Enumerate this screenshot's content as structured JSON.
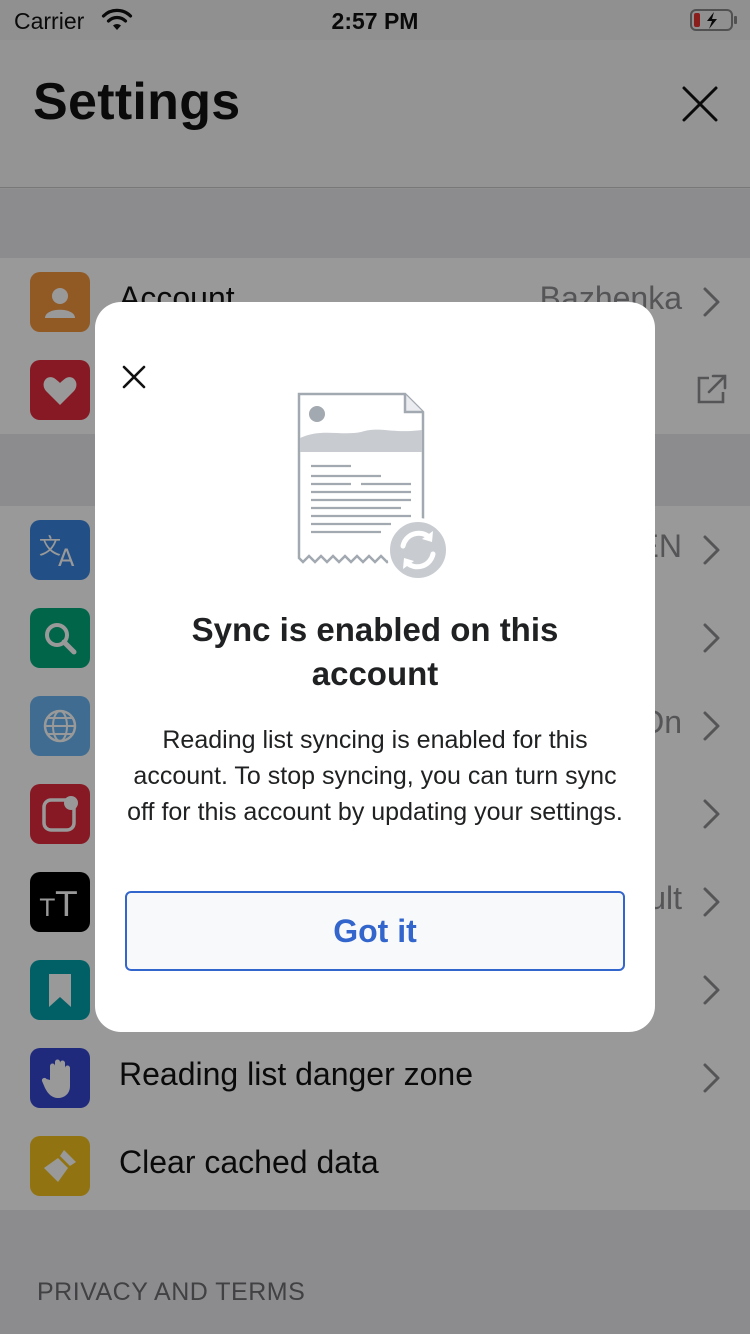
{
  "status_bar": {
    "carrier": "Carrier",
    "time": "2:57 PM"
  },
  "header": {
    "title": "Settings"
  },
  "settings": {
    "rows": [
      {
        "label": "Account",
        "value": "Bazhenka",
        "icon": "person-icon",
        "color": "#f2953c"
      },
      {
        "label": "",
        "value": "",
        "icon": "heart-icon",
        "color": "#e02a3b"
      },
      {
        "label": "",
        "value": "EN",
        "icon": "translate-icon",
        "color": "#3a86e0"
      },
      {
        "label": "",
        "value": "",
        "icon": "search-icon",
        "color": "#00a97a"
      },
      {
        "label": "",
        "value": "On",
        "icon": "globe-icon",
        "color": "#69b5f0"
      },
      {
        "label": "",
        "value": "",
        "icon": "notification-icon",
        "color": "#e02a3b"
      },
      {
        "label": "",
        "value": "ult",
        "icon": "text-size-icon",
        "color": "#000000"
      },
      {
        "label": "",
        "value": "",
        "icon": "bookmark-icon",
        "color": "#00a0a8"
      },
      {
        "label": "Reading list danger zone",
        "value": "",
        "icon": "hand-icon",
        "color": "#3447cf"
      },
      {
        "label": "Clear cached data",
        "value": "",
        "icon": "broom-icon",
        "color": "#f2c01d"
      }
    ],
    "privacy_header": "PRIVACY AND TERMS"
  },
  "modal": {
    "title": "Sync is enabled on this account",
    "body": "Reading list syncing is enabled for this account. To stop syncing, you can turn sync off for this account by updating your settings.",
    "button": "Got it",
    "accent": "#3366cc"
  }
}
